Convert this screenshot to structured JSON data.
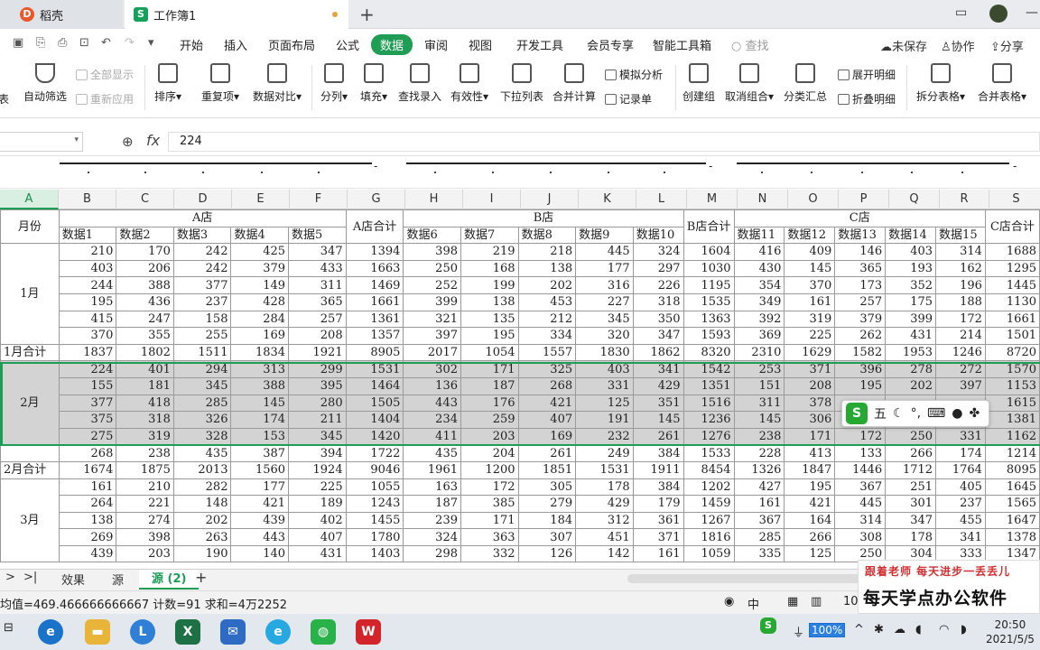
{
  "tabs": {
    "tab1": "稻壳",
    "tab2": "工作簿1",
    "new": "+"
  },
  "menus": [
    "开始",
    "插入",
    "页面布局",
    "公式",
    "数据",
    "审阅",
    "视图",
    "开发工具",
    "会员专享",
    "智能工具箱"
  ],
  "active_menu": "数据",
  "search": "查找",
  "right_actions": {
    "save": "未保存",
    "collab": "协作",
    "share": "分享"
  },
  "ribbon": {
    "autofilter": "自动筛选",
    "show_all": "全部显示",
    "reapply": "重新应用",
    "sort": "排序",
    "dup": "重复项",
    "compare": "数据对比",
    "split": "分列",
    "fill": "填充",
    "lookup": "查找录入",
    "validity": "有效性",
    "dropdown": "下拉列表",
    "consolidate": "合并计算",
    "simulate": "模拟分析",
    "record": "记录单",
    "group": "创建组",
    "ungroup": "取消组合",
    "subtotal": "分类汇总",
    "expand": "展开明细",
    "collapse": "折叠明细",
    "split_table": "拆分表格",
    "merge_table": "合并表格",
    "cut_left": "表"
  },
  "formula": {
    "fx": "fx",
    "value": "224"
  },
  "col_headers": [
    "A",
    "B",
    "C",
    "D",
    "E",
    "F",
    "G",
    "H",
    "I",
    "J",
    "K",
    "L",
    "M",
    "N",
    "O",
    "P",
    "Q",
    "R",
    "S"
  ],
  "store_headers": {
    "a": "A店",
    "b": "B店",
    "c": "C店",
    "a_total": "A店合计",
    "b_total": "B店合计",
    "c_total": "C店合计",
    "month": "月份"
  },
  "data_headers": [
    "数据1",
    "数据2",
    "数据3",
    "数据4",
    "数据5",
    "数据6",
    "数据7",
    "数据8",
    "数据9",
    "数据10",
    "数据11",
    "数据12",
    "数据13",
    "数据14",
    "数据15"
  ],
  "months": {
    "m1": "1月",
    "m1_total": "1月合计",
    "m2": "2月",
    "m2_total": "2月合计",
    "m3": "3月"
  },
  "rows_m1": [
    [
      "210",
      "170",
      "242",
      "425",
      "347",
      "1394",
      "398",
      "219",
      "218",
      "445",
      "324",
      "1604",
      "416",
      "409",
      "146",
      "403",
      "314",
      "1688"
    ],
    [
      "403",
      "206",
      "242",
      "379",
      "433",
      "1663",
      "250",
      "168",
      "138",
      "177",
      "297",
      "1030",
      "430",
      "145",
      "365",
      "193",
      "162",
      "1295"
    ],
    [
      "244",
      "388",
      "377",
      "149",
      "311",
      "1469",
      "252",
      "199",
      "202",
      "316",
      "226",
      "1195",
      "354",
      "370",
      "173",
      "352",
      "196",
      "1445"
    ],
    [
      "195",
      "436",
      "237",
      "428",
      "365",
      "1661",
      "399",
      "138",
      "453",
      "227",
      "318",
      "1535",
      "349",
      "161",
      "257",
      "175",
      "188",
      "1130"
    ],
    [
      "415",
      "247",
      "158",
      "284",
      "257",
      "1361",
      "321",
      "135",
      "212",
      "345",
      "350",
      "1363",
      "392",
      "319",
      "379",
      "399",
      "172",
      "1661"
    ],
    [
      "370",
      "355",
      "255",
      "169",
      "208",
      "1357",
      "397",
      "195",
      "334",
      "320",
      "347",
      "1593",
      "369",
      "225",
      "262",
      "431",
      "214",
      "1501"
    ]
  ],
  "total_m1": [
    "1837",
    "1802",
    "1511",
    "1834",
    "1921",
    "8905",
    "2017",
    "1054",
    "1557",
    "1830",
    "1862",
    "8320",
    "2310",
    "1629",
    "1582",
    "1953",
    "1246",
    "8720"
  ],
  "rows_m2": [
    [
      "224",
      "401",
      "294",
      "313",
      "299",
      "1531",
      "302",
      "171",
      "325",
      "403",
      "341",
      "1542",
      "253",
      "371",
      "396",
      "278",
      "272",
      "1570"
    ],
    [
      "155",
      "181",
      "345",
      "388",
      "395",
      "1464",
      "136",
      "187",
      "268",
      "331",
      "429",
      "1351",
      "151",
      "208",
      "195",
      "202",
      "397",
      "1153"
    ],
    [
      "377",
      "418",
      "285",
      "145",
      "280",
      "1505",
      "443",
      "176",
      "421",
      "125",
      "351",
      "1516",
      "311",
      "378",
      "",
      "",
      "",
      "1615"
    ],
    [
      "375",
      "318",
      "326",
      "174",
      "211",
      "1404",
      "234",
      "259",
      "407",
      "191",
      "145",
      "1236",
      "145",
      "306",
      "",
      "",
      "",
      "1381"
    ],
    [
      "275",
      "319",
      "328",
      "153",
      "345",
      "1420",
      "411",
      "203",
      "169",
      "232",
      "261",
      "1276",
      "238",
      "171",
      "172",
      "250",
      "331",
      "1162"
    ],
    [
      "268",
      "238",
      "435",
      "387",
      "394",
      "1722",
      "435",
      "204",
      "261",
      "249",
      "384",
      "1533",
      "228",
      "413",
      "133",
      "266",
      "174",
      "1214"
    ]
  ],
  "total_m2": [
    "1674",
    "1875",
    "2013",
    "1560",
    "1924",
    "9046",
    "1961",
    "1200",
    "1851",
    "1531",
    "1911",
    "8454",
    "1326",
    "1847",
    "1446",
    "1712",
    "1764",
    "8095"
  ],
  "rows_m3": [
    [
      "161",
      "210",
      "282",
      "177",
      "225",
      "1055",
      "163",
      "172",
      "305",
      "178",
      "384",
      "1202",
      "427",
      "195",
      "367",
      "251",
      "405",
      "1645"
    ],
    [
      "264",
      "221",
      "148",
      "421",
      "189",
      "1243",
      "187",
      "385",
      "279",
      "429",
      "179",
      "1459",
      "161",
      "421",
      "445",
      "301",
      "237",
      "1565"
    ],
    [
      "138",
      "274",
      "202",
      "439",
      "402",
      "1455",
      "239",
      "171",
      "184",
      "312",
      "361",
      "1267",
      "367",
      "164",
      "314",
      "347",
      "455",
      "1647"
    ],
    [
      "269",
      "398",
      "263",
      "443",
      "407",
      "1780",
      "324",
      "363",
      "307",
      "451",
      "371",
      "1816",
      "285",
      "266",
      "308",
      "178",
      "341",
      "1378"
    ],
    [
      "439",
      "203",
      "190",
      "140",
      "431",
      "1403",
      "298",
      "332",
      "126",
      "142",
      "161",
      "1059",
      "335",
      "125",
      "250",
      "304",
      "333",
      "1347"
    ]
  ],
  "sheet_tabs": {
    "t1": "效果",
    "t2": "源",
    "t3": "源 (2)",
    "add": "+"
  },
  "status": {
    "stats": "均值=469.466666666667 计数=91 求和=4万2252",
    "zoom": "10",
    "lang": "中"
  },
  "ime": {
    "mode": "五",
    "punct": "°,"
  },
  "watermark": {
    "line1": "跟着老师 每天进步一丢丢儿",
    "line2": "每天学点办公软件"
  },
  "taskbar": {
    "battery": "100%",
    "time": "20:50",
    "date": "2021/5/5"
  },
  "colors": {
    "accent": "#1f9d55",
    "selection": "#d3d3d3"
  }
}
